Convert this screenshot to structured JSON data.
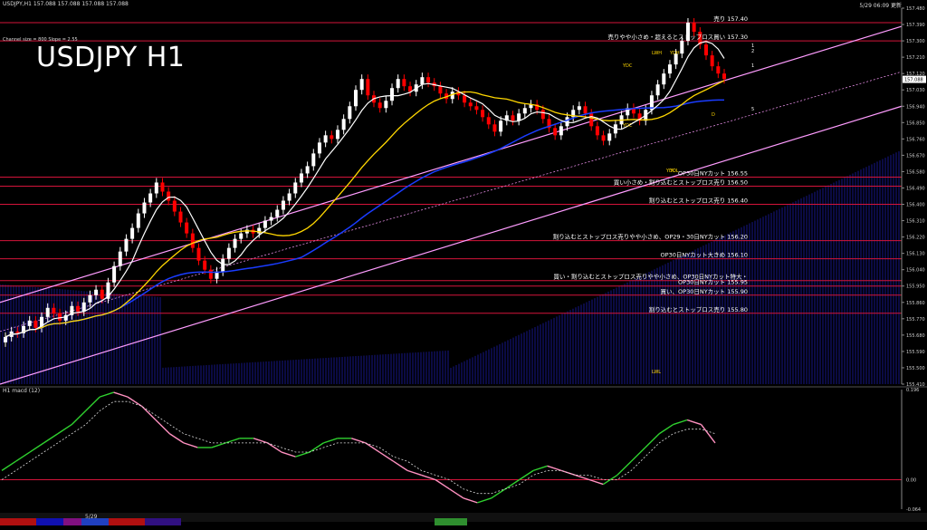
{
  "header": {
    "info": "USDJPY,H1  157.088 157.088 157.088 157.088",
    "datetime": "5/29 06:09 更新"
  },
  "title": "USDJPY H1",
  "channel_note": "Channel size = 800  Slope = 2.55",
  "macd_label": "H1 macd (12)",
  "footer": {
    "date": "5/29"
  },
  "colors": {
    "background": "#000000",
    "bull_candle": "#ffffff",
    "bear_candle": "#ff0000",
    "ma_fast": "#ffffff",
    "ma_mid": "#ffd700",
    "ma_slow": "#1a3cff",
    "channel": "#ff9cff",
    "cloud": "#1a1aa0",
    "level_line": "#d4143a",
    "macd_up": "#2fd12f",
    "macd_down": "#ff90c0"
  },
  "chart_data": {
    "type": "candlestick",
    "symbol": "USDJPY",
    "timeframe": "H1",
    "y_axis": {
      "labels": [
        "157.480",
        "157.390",
        "157.300",
        "157.210",
        "157.120",
        "157.030",
        "156.940",
        "156.850",
        "156.760",
        "156.670",
        "156.580",
        "156.490",
        "156.400",
        "156.310",
        "156.220",
        "156.130",
        "156.040",
        "155.950",
        "155.860",
        "155.770",
        "155.680",
        "155.590",
        "155.500",
        "155.410"
      ],
      "ylim": [
        155.41,
        157.48
      ],
      "current_price": "157.088"
    },
    "levels": [
      {
        "price": 157.4,
        "label": "売り 157.40"
      },
      {
        "price": 157.3,
        "label": "売りやや小さめ・超えるとストップロス買い 157.30"
      },
      {
        "price": 156.55,
        "label": "OP30日NYカット 156.55"
      },
      {
        "price": 156.5,
        "label": "買い小さめ・割り込むとストップロス売り 156.50"
      },
      {
        "price": 156.4,
        "label": "割り込むとストップロス売り 156.40"
      },
      {
        "price": 156.2,
        "label": "割り込むとストップロス売りやや小さめ、OP29・30日NYカット 156.20"
      },
      {
        "price": 156.1,
        "label": "OP30日NYカット大きめ 156.10"
      },
      {
        "price": 155.98,
        "label": "買い・割り込むとストップロス売りやや小さめ、OP30日NYカット特大・"
      },
      {
        "price": 155.95,
        "label": "OP30日NYカット 155.95"
      },
      {
        "price": 155.9,
        "label": "買い、OP30日NYカット 155.90"
      },
      {
        "price": 155.8,
        "label": "割り込むとストップロス売り 155.80"
      }
    ],
    "markers": [
      "1",
      "2",
      "1",
      "5",
      "YDC",
      "YDC",
      "YDC",
      "LWH",
      "YDH",
      "YDL",
      "LWL",
      "D"
    ],
    "closes": [
      155.67,
      155.7,
      155.69,
      155.73,
      155.76,
      155.72,
      155.78,
      155.83,
      155.8,
      155.76,
      155.79,
      155.84,
      155.81,
      155.86,
      155.9,
      155.93,
      155.88,
      155.97,
      156.06,
      156.14,
      156.21,
      156.27,
      156.35,
      156.41,
      156.46,
      156.52,
      156.47,
      156.42,
      156.36,
      156.3,
      156.24,
      156.16,
      156.09,
      156.04,
      155.99,
      156.03,
      156.1,
      156.16,
      156.21,
      156.24,
      156.26,
      156.24,
      156.27,
      156.31,
      156.33,
      156.37,
      156.42,
      156.46,
      156.52,
      156.57,
      156.61,
      156.68,
      156.74,
      156.78,
      156.76,
      156.81,
      156.87,
      156.94,
      157.03,
      157.09,
      157.0,
      156.96,
      156.93,
      156.97,
      157.04,
      157.09,
      157.05,
      157.02,
      157.06,
      157.1,
      157.07,
      157.05,
      157.01,
      156.98,
      157.02,
      157.0,
      156.96,
      156.94,
      156.92,
      156.88,
      156.84,
      156.8,
      156.86,
      156.89,
      156.86,
      156.9,
      156.93,
      156.95,
      156.92,
      156.87,
      156.82,
      156.78,
      156.83,
      156.88,
      156.92,
      156.94,
      156.9,
      156.83,
      156.78,
      156.75,
      156.79,
      156.84,
      156.89,
      156.93,
      156.9,
      156.86,
      156.92,
      157.0,
      157.06,
      157.12,
      157.17,
      157.23,
      157.3,
      157.4,
      157.35,
      157.28,
      157.22,
      157.16,
      157.12,
      157.09
    ]
  },
  "macd_data": {
    "type": "line",
    "y_labels": [
      "0.196",
      "0.00",
      "-0.064"
    ],
    "macd": [
      0.02,
      0.04,
      0.06,
      0.08,
      0.1,
      0.12,
      0.15,
      0.18,
      0.19,
      0.18,
      0.16,
      0.13,
      0.1,
      0.08,
      0.07,
      0.07,
      0.08,
      0.09,
      0.09,
      0.08,
      0.06,
      0.05,
      0.06,
      0.08,
      0.09,
      0.09,
      0.08,
      0.06,
      0.04,
      0.02,
      0.01,
      0.0,
      -0.02,
      -0.04,
      -0.05,
      -0.04,
      -0.02,
      0.0,
      0.02,
      0.03,
      0.02,
      0.01,
      0.0,
      -0.01,
      0.01,
      0.04,
      0.07,
      0.1,
      0.12,
      0.13,
      0.12,
      0.08
    ],
    "signal": [
      0.0,
      0.02,
      0.04,
      0.06,
      0.08,
      0.1,
      0.12,
      0.15,
      0.17,
      0.17,
      0.16,
      0.14,
      0.12,
      0.1,
      0.09,
      0.08,
      0.08,
      0.08,
      0.08,
      0.08,
      0.07,
      0.06,
      0.06,
      0.07,
      0.08,
      0.08,
      0.08,
      0.07,
      0.05,
      0.04,
      0.02,
      0.01,
      0.0,
      -0.02,
      -0.03,
      -0.03,
      -0.02,
      -0.01,
      0.01,
      0.02,
      0.02,
      0.01,
      0.01,
      0.0,
      0.0,
      0.02,
      0.05,
      0.08,
      0.1,
      0.11,
      0.11,
      0.1
    ]
  }
}
